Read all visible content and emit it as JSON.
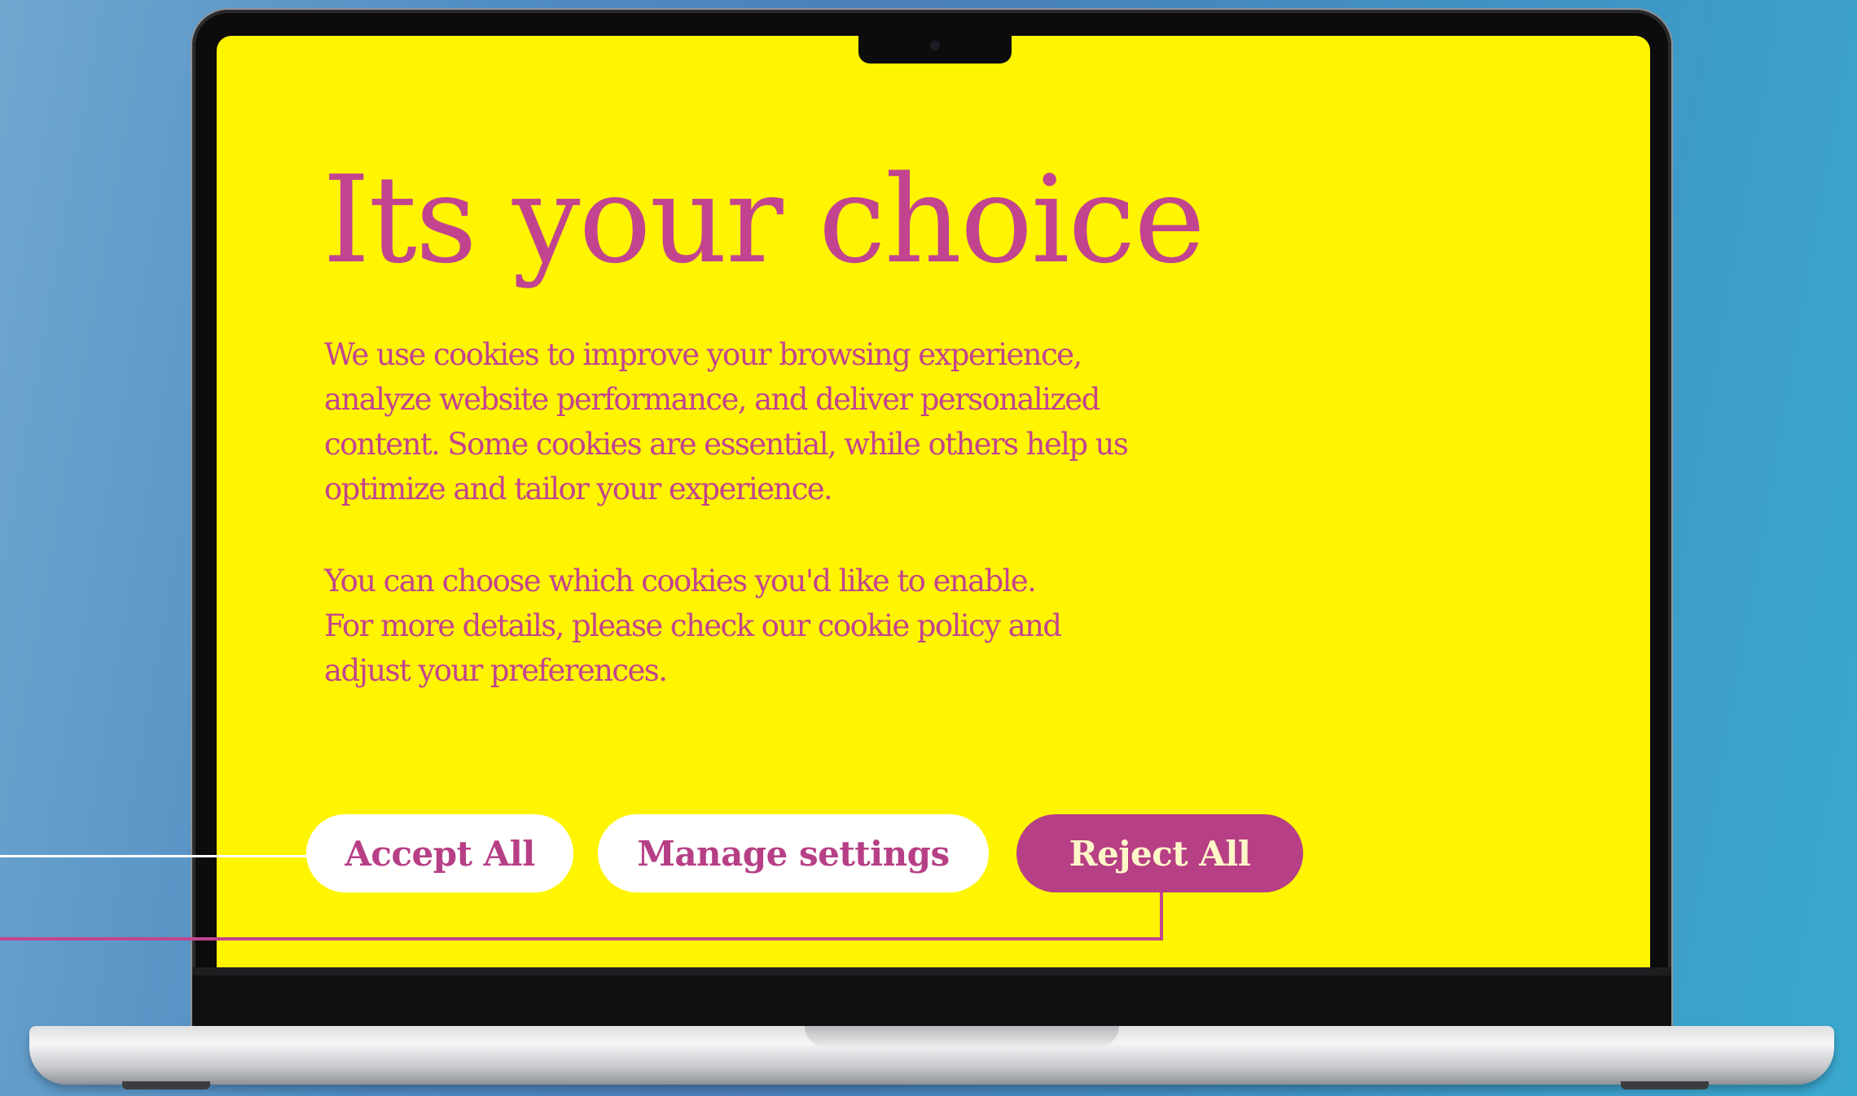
{
  "banner": {
    "title": "Its your choice",
    "paragraph1": "We use cookies to improve your browsing experience,\nanalyze website performance, and deliver personalized\ncontent. Some cookies are essential, while others help us\noptimize and tailor your experience.",
    "paragraph2": "You can choose which cookies you'd like to enable.\nFor more details, please check our cookie policy and\nadjust your preferences."
  },
  "buttons": {
    "accept_label": "Accept All",
    "manage_label": "Manage settings",
    "reject_label": "Reject All"
  },
  "colors": {
    "screen_background": "#fff500",
    "accent_magenta": "#c2448f",
    "button_light": "#ffffff",
    "button_reject": "#b73f86"
  }
}
